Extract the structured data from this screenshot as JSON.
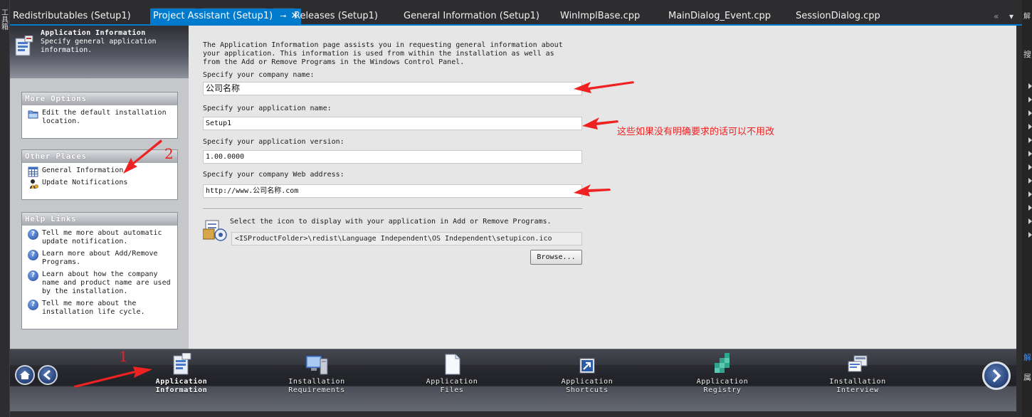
{
  "tabs": [
    {
      "label": "Redistributables (Setup1)"
    },
    {
      "label": "Project Assistant (Setup1)",
      "pin": "⊸",
      "close": "✕"
    },
    {
      "label": "Releases (Setup1)"
    },
    {
      "label": "General Information (Setup1)"
    },
    {
      "label": "WinImplBase.cpp"
    },
    {
      "label": "MainDialog_Event.cpp"
    },
    {
      "label": "SessionDialog.cpp"
    }
  ],
  "tab_controls": {
    "overflow": "«",
    "dropdown": "▾"
  },
  "side_strips": {
    "left_text": "工具箱",
    "right_top": "解",
    "right_search": "搜",
    "right_mark_1": "解",
    "right_mark_2": "属"
  },
  "header": {
    "title": "Application Information",
    "subtitle": "Specify general application information."
  },
  "sidebar": {
    "more_options": {
      "title": "More Options",
      "items": [
        {
          "label": "Edit the default installation location.",
          "icon": "folder-icon"
        }
      ]
    },
    "other_places": {
      "title": "Other Places",
      "items": [
        {
          "label": "General Information",
          "icon": "table-icon"
        },
        {
          "label": "Update Notifications",
          "icon": "update-icon"
        }
      ]
    },
    "help_links": {
      "title": "Help Links",
      "items": [
        {
          "label": "Tell me more about automatic update notification.",
          "icon": "help-icon"
        },
        {
          "label": "Learn more about Add/Remove Programs.",
          "icon": "help-icon"
        },
        {
          "label": "Learn about how the company name and product name are used by the installation.",
          "icon": "help-icon"
        },
        {
          "label": "Tell me more about the installation life cycle.",
          "icon": "help-icon"
        }
      ]
    }
  },
  "main": {
    "intro_lines": [
      "The Application Information page assists you in requesting general information about",
      "your application. This information is used from within the installation as well as",
      "from the Add or Remove Programs in the Windows Control Panel."
    ],
    "company_label": "Specify your company name:",
    "company_value": "公司名称",
    "app_name_label": "Specify your application name:",
    "app_name_value": "Setup1",
    "version_label": "Specify your application version:",
    "version_value": "1.00.0000",
    "web_label": "Specify your company Web address:",
    "web_value": "http://www.公司名称.com",
    "icon_label": "Select the icon to display with your application in Add or Remove Programs.",
    "icon_path": "<ISProductFolder>\\redist\\Language Independent\\OS Independent\\setupicon.ico",
    "browse_label": "Browse..."
  },
  "annotations": {
    "note": "这些如果没有明确要求的话可以不用改",
    "num_1": "1",
    "num_2": "2",
    "color": "#ee2222"
  },
  "navbar": {
    "home_icon": "home-icon",
    "back_icon": "back-icon",
    "next_icon": "next-icon",
    "steps": [
      {
        "line1": "Application",
        "line2": "Information",
        "icon": "app-info-icon",
        "active": true
      },
      {
        "line1": "Installation",
        "line2": "Requirements",
        "icon": "requirements-icon"
      },
      {
        "line1": "Application",
        "line2": "Files",
        "icon": "files-icon"
      },
      {
        "line1": "Application",
        "line2": "Shortcuts",
        "icon": "shortcut-icon"
      },
      {
        "line1": "Application",
        "line2": "Registry",
        "icon": "registry-icon"
      },
      {
        "line1": "Installation",
        "line2": "Interview",
        "icon": "interview-icon"
      }
    ]
  },
  "colors": {
    "accent": "#007acc",
    "ide_bg": "#2d2d30",
    "panel_bg": "#c5c7cb",
    "main_bg": "#e6e6e6"
  }
}
